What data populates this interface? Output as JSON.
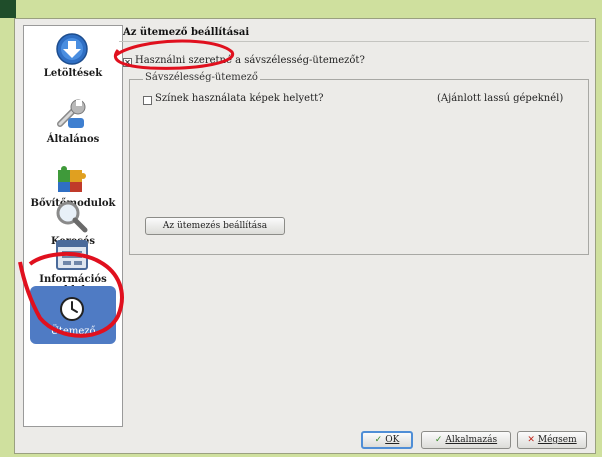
{
  "dialog": {
    "sidebar": {
      "items": [
        {
          "label": "Letöltések",
          "icon": "download-icon"
        },
        {
          "label": "Általános",
          "icon": "wrench-icon"
        },
        {
          "label": "Bővítőmodulok",
          "icon": "puzzle-icon"
        },
        {
          "label": "Keresés",
          "icon": "magnifier-icon"
        },
        {
          "label": "Információs ablak",
          "icon": "window-icon"
        },
        {
          "label": "Ütemező",
          "icon": "clock-icon",
          "selected": true
        }
      ]
    },
    "panel": {
      "title": "Az ütemező beállításai",
      "enable_checkbox": {
        "label": "Használni szeretné a sávszélesség-ütemezőt?",
        "checked": true
      },
      "group": {
        "legend": "Sávszélesség-ütemező",
        "colors_checkbox": {
          "label": "Színek használata képek helyett?",
          "checked": false
        },
        "colors_hint": "(Ajánlott lassú gépeknél)",
        "configure_button": "Az ütemezés beállítása"
      }
    },
    "footer": {
      "ok": "OK",
      "apply": "Alkalmazás",
      "cancel": "Mégsem"
    }
  },
  "colors": {
    "background": "#cfe09e",
    "selection": "#4f7bc4",
    "annotation": "#e0101e"
  }
}
